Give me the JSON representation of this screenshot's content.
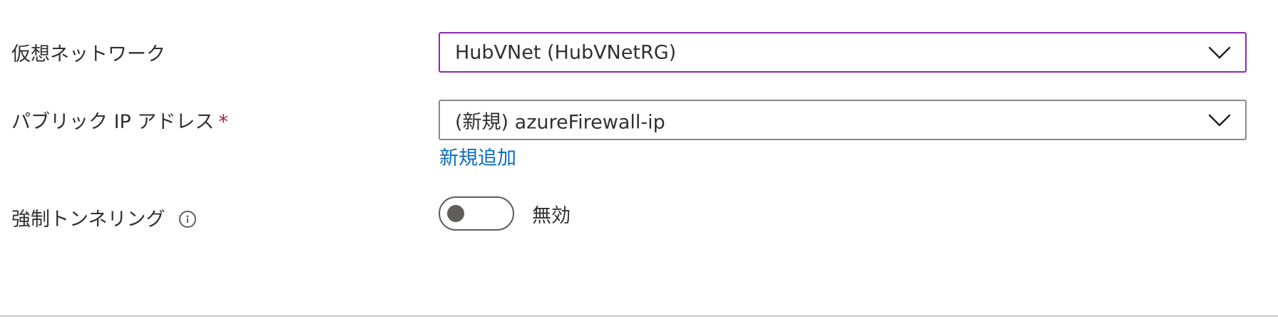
{
  "form": {
    "virtual_network": {
      "label": "仮想ネットワーク",
      "value": "HubVNet (HubVNetRG)"
    },
    "public_ip": {
      "label": "パブリック IP アドレス",
      "required_marker": "*",
      "value": "(新規) azureFirewall-ip",
      "add_new_link": "新規追加"
    },
    "forced_tunneling": {
      "label": "強制トンネリング",
      "info_icon": "info-icon",
      "toggle_on": false,
      "toggle_state_label": "無効"
    }
  },
  "colors": {
    "focus_border": "#8a2bb2",
    "link": "#0f6cbd",
    "required": "#a4262c",
    "text": "#323130",
    "divider": "#c8c6c4"
  }
}
